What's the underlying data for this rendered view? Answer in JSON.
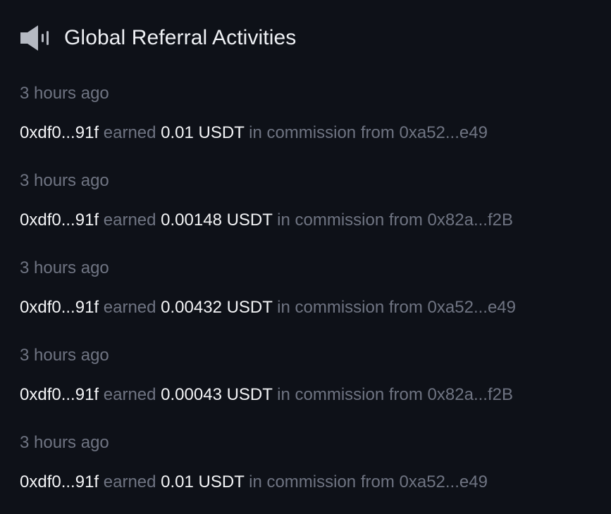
{
  "header": {
    "title": "Global Referral Activities",
    "icon": "speaker-icon"
  },
  "colors": {
    "background": "#0e1118",
    "primary_text": "#f3f4f6",
    "muted_text": "#6f7482",
    "icon": "#b5b9c2"
  },
  "activities": [
    {
      "time": "3 hours ago",
      "referrer": "0xdf0...91f",
      "earned_word": "earned",
      "amount": "0.01 USDT",
      "suffix": "in commission from",
      "source": "0xa52...e49"
    },
    {
      "time": "3 hours ago",
      "referrer": "0xdf0...91f",
      "earned_word": "earned",
      "amount": "0.00148 USDT",
      "suffix": "in commission from",
      "source": "0x82a...f2B"
    },
    {
      "time": "3 hours ago",
      "referrer": "0xdf0...91f",
      "earned_word": "earned",
      "amount": "0.00432 USDT",
      "suffix": "in commission from",
      "source": "0xa52...e49"
    },
    {
      "time": "3 hours ago",
      "referrer": "0xdf0...91f",
      "earned_word": "earned",
      "amount": "0.00043 USDT",
      "suffix": "in commission from",
      "source": "0x82a...f2B"
    },
    {
      "time": "3 hours ago",
      "referrer": "0xdf0...91f",
      "earned_word": "earned",
      "amount": "0.01 USDT",
      "suffix": "in commission from",
      "source": "0xa52...e49"
    }
  ]
}
